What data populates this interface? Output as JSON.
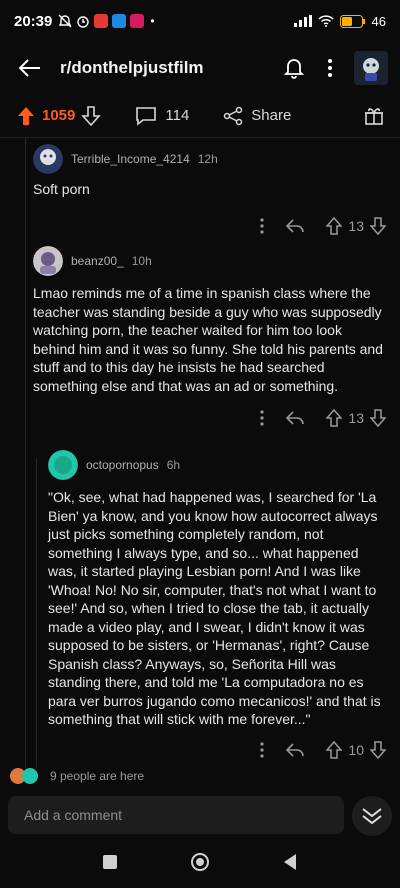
{
  "status": {
    "time": "20:39",
    "battery": "46",
    "colors": {
      "app1": "#e53935",
      "app2": "#1e88e5",
      "app3": "#d81b60"
    }
  },
  "header": {
    "title": "r/donthelpjustfilm",
    "icons": [
      "back-arrow-icon",
      "bell-icon",
      "more-icon",
      "avatar"
    ]
  },
  "post_actions": {
    "votes": "1059",
    "comments": "114",
    "share": "Share"
  },
  "comments": [
    {
      "user": "Terrible_Income_4214",
      "age": "12h",
      "body": "Soft porn",
      "votes": "13"
    },
    {
      "user": "beanz00_",
      "age": "10h",
      "body": "Lmao reminds me of a time in spanish class where the teacher was standing beside a guy who was supposedly watching porn, the teacher waited for him too look behind him and it was so funny. She told his parents and stuff and to this day he insists he had searched something else and that was an ad or something.",
      "votes": "13"
    },
    {
      "user": "octopornopus",
      "age": "6h",
      "body": "\"Ok, see, what had happened was, I searched for 'La Bien' ya know, and you know how autocorrect always just picks something completely random, not something I always type, and so... what happened was, it started playing Lesbian porn! And I was like 'Whoa! No! No sir, computer, that's not what I want to see!' And so, when I tried to close the tab, it actually made a video play, and I swear, I didn't know it was supposed to be sisters, or 'Hermanas', right? Cause Spanish class? Anyways, so, Señorita Hill was standing there, and told me 'La computadora no es para ver burros jugando como mecanicos!' and that is something that will stick with me forever...\"",
      "votes": "10"
    }
  ],
  "presence": {
    "text": "9 people are here"
  },
  "composer": {
    "placeholder": "Add a comment"
  },
  "theme": {
    "accent": "#ff5a1f",
    "bg": "#0b0b0b",
    "avatar2": "#c9c4c7",
    "avatar3": "#21c7a8"
  }
}
